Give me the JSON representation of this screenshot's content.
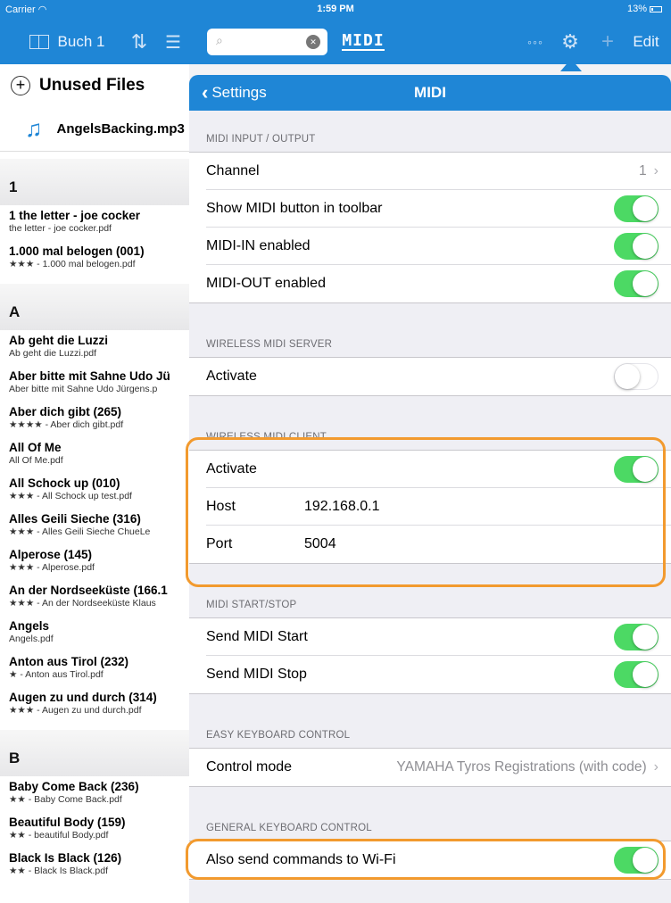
{
  "status_bar": {
    "carrier": "Carrier",
    "time": "1:59 PM",
    "battery": "13%"
  },
  "toolbar": {
    "book_label": "Buch 1",
    "search_placeholder": "",
    "midi_logo": "MIDI",
    "edit_label": "Edit"
  },
  "left_list": {
    "unused_header": "Unused Files",
    "unused_file": "AngelsBacking.mp3",
    "sections": [
      {
        "letter": "1",
        "songs": [
          {
            "title": "1 the letter - joe cocker",
            "subtitle": "the letter - joe cocker.pdf"
          },
          {
            "title": "1.000 mal belogen (001)",
            "subtitle": "★★★ - 1.000 mal belogen.pdf"
          }
        ]
      },
      {
        "letter": "A",
        "songs": [
          {
            "title": "Ab geht die Luzzi",
            "subtitle": "Ab geht die Luzzi.pdf"
          },
          {
            "title": "Aber bitte mit Sahne Udo Jü",
            "subtitle": "Aber bitte mit Sahne Udo Jürgens.p"
          },
          {
            "title": "Aber dich gibt (265)",
            "subtitle": "★★★★ - Aber dich gibt.pdf"
          },
          {
            "title": "All Of Me",
            "subtitle": "All Of Me.pdf"
          },
          {
            "title": "All Schock up (010)",
            "subtitle": "★★★ - All Schock up test.pdf"
          },
          {
            "title": "Alles Geili Sieche (316)",
            "subtitle": "★★★ - Alles Geili Sieche   ChueLe"
          },
          {
            "title": "Alperose (145)",
            "subtitle": "★★★ - Alperose.pdf"
          },
          {
            "title": "An der Nordseeküste (166.1",
            "subtitle": "★★★ - An der Nordseeküste Klaus"
          },
          {
            "title": "Angels",
            "subtitle": "Angels.pdf"
          },
          {
            "title": "Anton aus Tirol (232)",
            "subtitle": "★ - Anton aus Tirol.pdf"
          },
          {
            "title": "Augen zu und durch (314)",
            "subtitle": "★★★ - Augen zu und durch.pdf"
          }
        ]
      },
      {
        "letter": "B",
        "songs": [
          {
            "title": "Baby Come Back (236)",
            "subtitle": "★★ - Baby Come Back.pdf"
          },
          {
            "title": "Beautiful Body (159)",
            "subtitle": "★★ - beautiful Body.pdf"
          },
          {
            "title": "Black Is Black (126)",
            "subtitle": "★★ - Black Is Black.pdf"
          }
        ]
      }
    ]
  },
  "settings": {
    "back_label": "Settings",
    "title": "MIDI",
    "groups": [
      {
        "header": "MIDI INPUT / OUTPUT",
        "cells": [
          {
            "label": "Channel",
            "detail": "1",
            "disclosure": true
          },
          {
            "label": "Show MIDI button in toolbar",
            "toggle": true
          },
          {
            "label": "MIDI-IN enabled",
            "toggle": true
          },
          {
            "label": "MIDI-OUT enabled",
            "toggle": true
          }
        ]
      },
      {
        "header": "WIRELESS MIDI SERVER",
        "cells": [
          {
            "label": "Activate",
            "toggle": false
          }
        ]
      },
      {
        "header": "WIRELESS MIDI CLIENT",
        "cells": [
          {
            "label": "Activate",
            "toggle": true
          },
          {
            "label": "Host",
            "value": "192.168.0.1"
          },
          {
            "label": "Port",
            "value": "5004"
          }
        ]
      },
      {
        "header": "MIDI START/STOP",
        "cells": [
          {
            "label": "Send MIDI Start",
            "toggle": true
          },
          {
            "label": "Send MIDI Stop",
            "toggle": true
          }
        ]
      },
      {
        "header": "EASY KEYBOARD CONTROL",
        "cells": [
          {
            "label": "Control mode",
            "detail": "YAMAHA Tyros Registrations (with code)",
            "disclosure": true
          }
        ]
      },
      {
        "header": "GENERAL KEYBOARD CONTROL",
        "cells": [
          {
            "label": "Also send commands to Wi-Fi",
            "toggle": true
          }
        ]
      }
    ]
  },
  "colors": {
    "accent": "#1f86d6",
    "toggle_on": "#4cd964",
    "highlight": "#f29a2e"
  }
}
